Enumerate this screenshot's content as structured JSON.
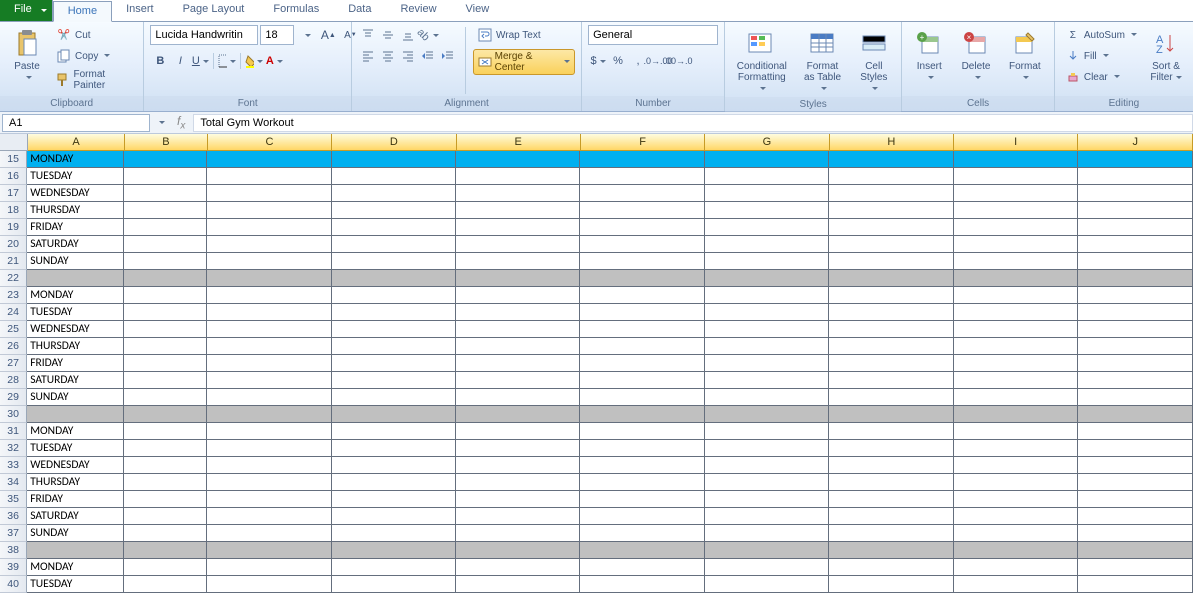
{
  "tabs": {
    "file": "File",
    "items": [
      "Home",
      "Insert",
      "Page Layout",
      "Formulas",
      "Data",
      "Review",
      "View"
    ],
    "active": "Home"
  },
  "ribbon": {
    "clipboard": {
      "title": "Clipboard",
      "paste": "Paste",
      "cut": "Cut",
      "copy": "Copy",
      "format_painter": "Format Painter"
    },
    "font": {
      "title": "Font",
      "name": "Lucida Handwritin",
      "size": "18"
    },
    "alignment": {
      "title": "Alignment",
      "wrap": "Wrap Text",
      "merge": "Merge & Center"
    },
    "number": {
      "title": "Number",
      "format": "General"
    },
    "styles": {
      "title": "Styles",
      "cond": "Conditional\nFormatting",
      "table": "Format\nas Table",
      "cell": "Cell\nStyles"
    },
    "cells": {
      "title": "Cells",
      "insert": "Insert",
      "delete": "Delete",
      "format": "Format"
    },
    "editing": {
      "title": "Editing",
      "autosum": "AutoSum",
      "fill": "Fill",
      "clear": "Clear",
      "sort": "Sort &\nFilter"
    }
  },
  "name_box": "A1",
  "formula": "Total Gym Workout",
  "columns": [
    {
      "letter": "A",
      "w": 100
    },
    {
      "letter": "B",
      "w": 85
    },
    {
      "letter": "C",
      "w": 128
    },
    {
      "letter": "D",
      "w": 128
    },
    {
      "letter": "E",
      "w": 128
    },
    {
      "letter": "F",
      "w": 128
    },
    {
      "letter": "G",
      "w": 128
    },
    {
      "letter": "H",
      "w": 128
    },
    {
      "letter": "I",
      "w": 128
    },
    {
      "letter": "J",
      "w": 118
    }
  ],
  "rows": [
    {
      "n": 15,
      "a": "MONDAY",
      "style": "blue"
    },
    {
      "n": 16,
      "a": "TUESDAY"
    },
    {
      "n": 17,
      "a": "WEDNESDAY"
    },
    {
      "n": 18,
      "a": "THURSDAY"
    },
    {
      "n": 19,
      "a": "FRIDAY"
    },
    {
      "n": 20,
      "a": "SATURDAY"
    },
    {
      "n": 21,
      "a": "SUNDAY"
    },
    {
      "n": 22,
      "a": "",
      "style": "grey"
    },
    {
      "n": 23,
      "a": "MONDAY"
    },
    {
      "n": 24,
      "a": "TUESDAY"
    },
    {
      "n": 25,
      "a": "WEDNESDAY"
    },
    {
      "n": 26,
      "a": "THURSDAY"
    },
    {
      "n": 27,
      "a": "FRIDAY"
    },
    {
      "n": 28,
      "a": "SATURDAY"
    },
    {
      "n": 29,
      "a": "SUNDAY"
    },
    {
      "n": 30,
      "a": "",
      "style": "grey"
    },
    {
      "n": 31,
      "a": "MONDAY"
    },
    {
      "n": 32,
      "a": "TUESDAY"
    },
    {
      "n": 33,
      "a": "WEDNESDAY"
    },
    {
      "n": 34,
      "a": "THURSDAY"
    },
    {
      "n": 35,
      "a": "FRIDAY"
    },
    {
      "n": 36,
      "a": "SATURDAY"
    },
    {
      "n": 37,
      "a": "SUNDAY"
    },
    {
      "n": 38,
      "a": "",
      "style": "grey"
    },
    {
      "n": 39,
      "a": "MONDAY"
    },
    {
      "n": 40,
      "a": "TUESDAY"
    }
  ]
}
